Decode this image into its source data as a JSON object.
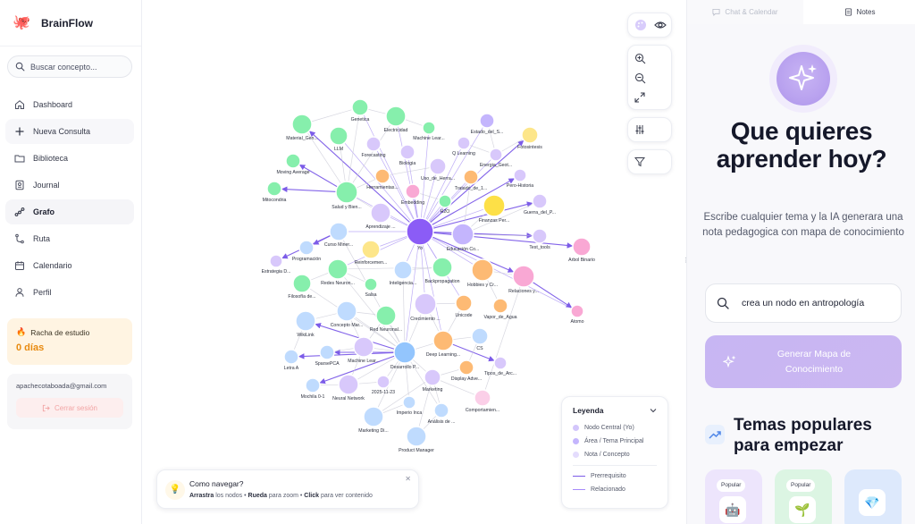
{
  "brand": {
    "name": "BrainFlow",
    "logo_icon": "octopus-icon"
  },
  "search": {
    "placeholder": "Buscar concepto..."
  },
  "nav": [
    {
      "label": "Dashboard",
      "icon": "home-icon"
    },
    {
      "label": "Nueva Consulta",
      "icon": "plus-icon"
    },
    {
      "label": "Biblioteca",
      "icon": "folder-icon"
    },
    {
      "label": "Journal",
      "icon": "journal-icon"
    },
    {
      "label": "Grafo",
      "icon": "graph-icon"
    },
    {
      "label": "Ruta",
      "icon": "route-icon"
    },
    {
      "label": "Calendario",
      "icon": "calendar-icon"
    },
    {
      "label": "Perfil",
      "icon": "user-icon"
    }
  ],
  "streak": {
    "title": "Racha de estudio",
    "value": "0 días"
  },
  "account": {
    "email": "apachecotaboada@gmail.com",
    "logout_label": "Cerrar sesión"
  },
  "help": {
    "title": "Como navegar?",
    "d1": "Arrastra",
    "d2": " los nodos • ",
    "d3": "Rueda",
    "d4": " para zoom • ",
    "d5": "Click",
    "d6": " para ver contenido"
  },
  "legend": {
    "title": "Leyenda",
    "items": [
      "Nodo Central (Yo)",
      "Área / Tema Principal",
      "Nota / Concepto"
    ],
    "lines": [
      "Prerrequisito",
      "Relacionado"
    ],
    "colors": {
      "central": "#8b5cf6",
      "area": "#a78bfa",
      "note": "#ddd6fe",
      "prereq": "#7c5ce8",
      "related": "#a78bfa"
    }
  },
  "panel": {
    "tabs": [
      "Chat & Calendar",
      "Notes"
    ],
    "hero_title": "Que quieres aprender hoy?",
    "hero_sub": "Escribe cualquier tema y la IA generara una nota pedagogica con mapa de conocimiento",
    "prompt_value": "crea un nodo en antropología",
    "generate_label": "Generar Mapa de Conocimiento",
    "popular_title": "Temas populares para empezar",
    "cards": [
      {
        "badge": "Popular",
        "icon": "robot-icon",
        "emoji": "🤖"
      },
      {
        "badge": "Popular",
        "icon": "sprout-icon",
        "emoji": "🌱"
      },
      {
        "badge": "",
        "icon": "gem-icon",
        "emoji": "💎"
      }
    ]
  },
  "graph": {
    "nodes": [
      {
        "id": "yo",
        "label": "Yo",
        "c": "#8b5cf6"
      },
      {
        "id": "genetica",
        "label": "Genetica",
        "c": "#86efac"
      },
      {
        "id": "electricidad",
        "label": "Electricidad",
        "c": "#86efac"
      },
      {
        "id": "material",
        "label": "Material_Gen...",
        "c": "#86efac"
      },
      {
        "id": "llm",
        "label": "LLM",
        "c": "#86efac"
      },
      {
        "id": "mlearn1",
        "label": "Machine Lear...",
        "c": "#86efac"
      },
      {
        "id": "estado",
        "label": "Estado_del_S...",
        "c": "#c4b5fd"
      },
      {
        "id": "fotosintesis",
        "label": "Fotosintesis",
        "c": "#fde68a"
      },
      {
        "id": "forecasting",
        "label": "Forecasting",
        "c": "#d8c8fb"
      },
      {
        "id": "qlearning",
        "label": "Q Learning",
        "c": "#d8c8fb"
      },
      {
        "id": "energia",
        "label": "Energia_Geot...",
        "c": "#d8c8fb"
      },
      {
        "id": "moving",
        "label": "Moving Average",
        "c": "#86efac"
      },
      {
        "id": "biologia",
        "label": "Biologia",
        "c": "#d8c8fb"
      },
      {
        "id": "herramientas",
        "label": "Herramientas...",
        "c": "#fdba74"
      },
      {
        "id": "uso",
        "label": "Uso_de_Herra...",
        "c": "#d8c8fb"
      },
      {
        "id": "tratado",
        "label": "Tratado_de_1...",
        "c": "#fdba74"
      },
      {
        "id": "pero",
        "label": "Pero-Historia",
        "c": "#d8c8fb"
      },
      {
        "id": "mitocondria",
        "label": "Mitocondria",
        "c": "#86efac"
      },
      {
        "id": "salud",
        "label": "Salud y Bien...",
        "c": "#86efac"
      },
      {
        "id": "embedding",
        "label": "Embedding",
        "c": "#f9a8d4"
      },
      {
        "id": "h2o",
        "label": "H2O",
        "c": "#86efac"
      },
      {
        "id": "finanzas",
        "label": "Finanzas Per...",
        "c": "#fde047"
      },
      {
        "id": "guerra",
        "label": "Guerra_del_P...",
        "c": "#d8c8fb"
      },
      {
        "id": "aprendizaje",
        "label": "Aprendizaje ...",
        "c": "#d8c8fb"
      },
      {
        "id": "educacion",
        "label": "Educación Co...",
        "c": "#c4b5fd"
      },
      {
        "id": "test",
        "label": "Test_tools",
        "c": "#d8c8fb"
      },
      {
        "id": "arbol",
        "label": "Arbol Binario",
        "c": "#f9a8d4"
      },
      {
        "id": "curso",
        "label": "Curso Miner...",
        "c": "#bfdbfe"
      },
      {
        "id": "programacion",
        "label": "Programación",
        "c": "#bfdbfe"
      },
      {
        "id": "reforzamiento",
        "label": "Reinforcemen...",
        "c": "#fde68a"
      },
      {
        "id": "estrategia",
        "label": "Estrategia D...",
        "c": "#d8c8fb"
      },
      {
        "id": "redes",
        "label": "Redes Neuron...",
        "c": "#86efac"
      },
      {
        "id": "inteligencia",
        "label": "Inteligencia...",
        "c": "#bfdbfe"
      },
      {
        "id": "backprop",
        "label": "Backpropagation",
        "c": "#86efac"
      },
      {
        "id": "hobbies",
        "label": "Hobbies y Cr...",
        "c": "#fdba74"
      },
      {
        "id": "relaciones",
        "label": "Relaciones y...",
        "c": "#f9a8d4"
      },
      {
        "id": "filosofia",
        "label": "Filosofía de...",
        "c": "#86efac"
      },
      {
        "id": "salsa",
        "label": "Salsa",
        "c": "#86efac"
      },
      {
        "id": "crecimiento",
        "label": "Crecimiento ...",
        "c": "#d8c8fb"
      },
      {
        "id": "unicode",
        "label": "Unicode",
        "c": "#fdba74"
      },
      {
        "id": "vapor",
        "label": "Vapor_de_Agua",
        "c": "#fdba74"
      },
      {
        "id": "atomo",
        "label": "Atomo",
        "c": "#f9a8d4"
      },
      {
        "id": "wikilink",
        "label": "WikiLink",
        "c": "#bfdbfe"
      },
      {
        "id": "concepto",
        "label": "Concepto Mar...",
        "c": "#bfdbfe"
      },
      {
        "id": "redneuronal",
        "label": "Red Neuronal...",
        "c": "#86efac"
      },
      {
        "id": "cs",
        "label": "CS",
        "c": "#bfdbfe"
      },
      {
        "id": "deep",
        "label": "Deep Learning...",
        "c": "#fdba74"
      },
      {
        "id": "letra",
        "label": "Letra A",
        "c": "#bfdbfe"
      },
      {
        "id": "sparse",
        "label": "SparsePCA",
        "c": "#bfdbfe"
      },
      {
        "id": "mlearn2",
        "label": "Machine Lear...",
        "c": "#d8c8fb"
      },
      {
        "id": "desarrollo",
        "label": "Desarrollo P...",
        "c": "#93c5fd"
      },
      {
        "id": "tipos",
        "label": "Tipos_de_Arc...",
        "c": "#d8c8fb"
      },
      {
        "id": "display",
        "label": "Display Adve...",
        "c": "#fdba74"
      },
      {
        "id": "mochila",
        "label": "Mochila 0-1",
        "c": "#bfdbfe"
      },
      {
        "id": "neural",
        "label": "Neural Network",
        "c": "#d8c8fb"
      },
      {
        "id": "fecha",
        "label": "2025-11-23",
        "c": "#d8c8fb"
      },
      {
        "id": "marketing",
        "label": "Marketing",
        "c": "#d8c8fb"
      },
      {
        "id": "comportamiento",
        "label": "Comportamien...",
        "c": "#fbcfe8"
      },
      {
        "id": "imperio",
        "label": "Imperio Inca",
        "c": "#bfdbfe"
      },
      {
        "id": "analisis",
        "label": "Análisis de ...",
        "c": "#bfdbfe"
      },
      {
        "id": "mktdigital",
        "label": "Marketing Di...",
        "c": "#bfdbfe"
      },
      {
        "id": "product",
        "label": "Product Manager",
        "c": "#bfdbfe"
      }
    ]
  }
}
